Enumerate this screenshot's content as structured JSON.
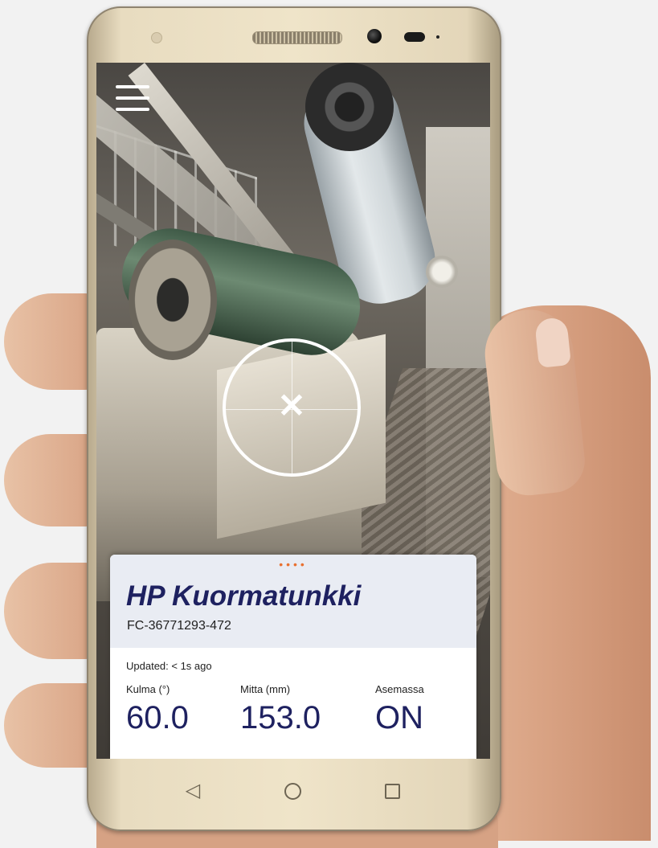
{
  "nav_icons": {
    "menu": "hamburger-menu-icon",
    "back": "back-triangle-icon",
    "home": "home-circle-icon",
    "recents": "recents-square-icon",
    "reticle": "crosshair-icon"
  },
  "card": {
    "pager_dots": "••••",
    "title": "HP Kuormatunkki",
    "id": "FC-36771293-472",
    "updated": "Updated: < 1s ago",
    "metrics": [
      {
        "label": "Kulma (°)",
        "value": "60.0"
      },
      {
        "label": "Mitta (mm)",
        "value": "153.0"
      },
      {
        "label": "Asemassa",
        "value": "ON"
      }
    ]
  },
  "nav": {
    "back": "◁"
  },
  "colors": {
    "title": "#1e2160",
    "accent_dots": "#e9702f",
    "card_header": "#e9ecf3"
  }
}
